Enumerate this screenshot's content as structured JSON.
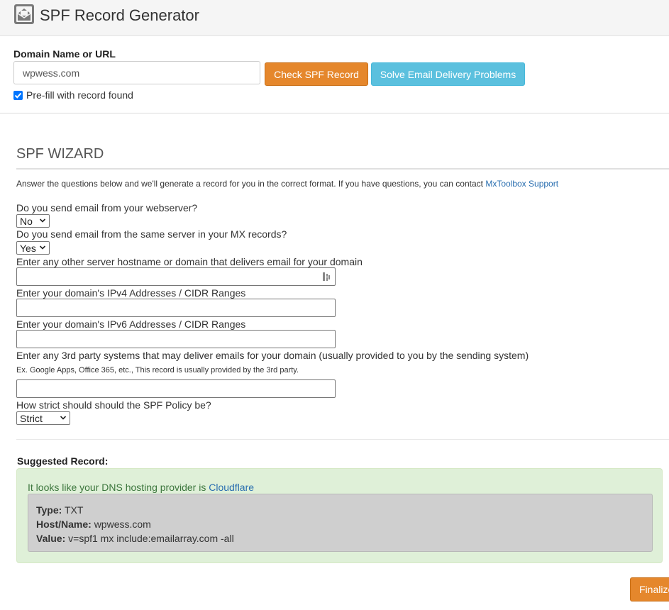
{
  "header": {
    "title": "SPF Record Generator"
  },
  "domain_form": {
    "label": "Domain Name or URL",
    "value": "wpwess.com",
    "check_button": "Check SPF Record",
    "solve_button": "Solve Email Delivery Problems",
    "prefill_label": "Pre-fill with record found",
    "prefill_checked": true
  },
  "wizard": {
    "title": "SPF WIZARD",
    "intro": "Answer the questions below and we'll generate a record for you in the correct format. If you have questions, you can contact ",
    "intro_link": "MxToolbox Support",
    "q1": "Do you send email from your webserver?",
    "q1_value": "No",
    "q2": "Do you send email from the same server in your MX records?",
    "q2_value": "Yes",
    "q3": "Enter any other server hostname or domain that delivers email for your domain",
    "q3_value": "",
    "q4": "Enter your domain's IPv4 Addresses / CIDR Ranges",
    "q4_value": "",
    "q5": "Enter your domain's IPv6 Addresses / CIDR Ranges",
    "q5_value": "",
    "q6": "Enter any 3rd party systems that may deliver emails for your domain (usually provided to you by the sending system)",
    "q6_hint": "Ex. Google Apps, Office 365, etc., This record is usually provided by the 3rd party.",
    "q6_value": "",
    "q7": "How strict should should the SPF Policy be?",
    "q7_value": "Strict"
  },
  "suggested": {
    "label": "Suggested Record:",
    "provider_text": "It looks like your DNS hosting provider is ",
    "provider_link": "Cloudflare",
    "type_label": "Type:",
    "type_value": "TXT",
    "host_label": "Host/Name:",
    "host_value": "wpwess.com",
    "value_label": "Value:",
    "value_value": "v=spf1 mx include:emailarray.com -all"
  },
  "footer": {
    "finalize_button": "Finalize"
  },
  "colors": {
    "orange": "#e5872c",
    "blue": "#5bc0de",
    "success_bg": "#dff0d8",
    "link": "#2a6fb0"
  }
}
